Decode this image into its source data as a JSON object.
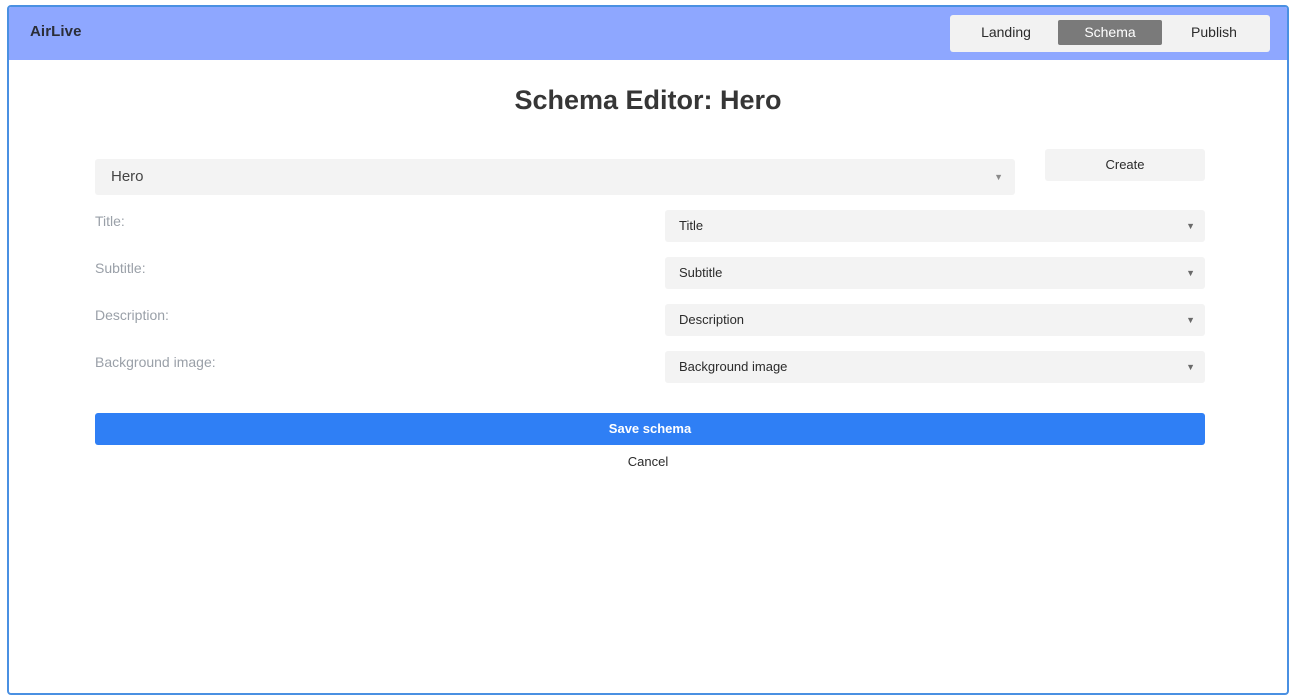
{
  "app": {
    "brand": "AirLive"
  },
  "nav": {
    "tabs": [
      {
        "label": "Landing",
        "active": false
      },
      {
        "label": "Schema",
        "active": true
      },
      {
        "label": "Publish",
        "active": false
      }
    ]
  },
  "main": {
    "title": "Schema Editor: Hero",
    "schema_select": {
      "value": "Hero"
    },
    "create_label": "Create",
    "fields": [
      {
        "label": "Title:",
        "value": "Title"
      },
      {
        "label": "Subtitle:",
        "value": "Subtitle"
      },
      {
        "label": "Description:",
        "value": "Description"
      },
      {
        "label": "Background image:",
        "value": "Background image"
      }
    ],
    "save_label": "Save schema",
    "cancel_label": "Cancel"
  },
  "colors": {
    "header": "#8ea7ff",
    "primary": "#2f7ff5",
    "active_tab": "#7a7a7a",
    "window_border": "#4a90e2"
  },
  "icons": {
    "dropdown": "caret-down-icon"
  }
}
